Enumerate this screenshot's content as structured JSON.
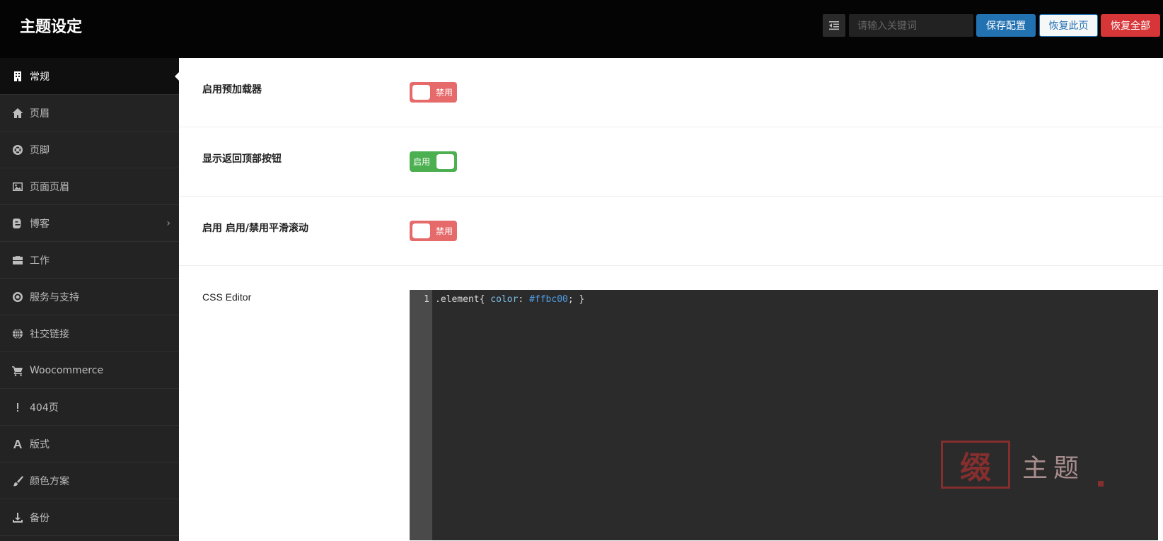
{
  "header": {
    "title": "主题设定",
    "search_placeholder": "请输入关键词",
    "save_label": "保存配置",
    "restore_label": "恢复此页",
    "reset_label": "恢复全部"
  },
  "sidebar": {
    "items": [
      {
        "label": "常规",
        "icon": "building-icon"
      },
      {
        "label": "页眉",
        "icon": "home-icon"
      },
      {
        "label": "页脚",
        "icon": "lifebuoy-icon"
      },
      {
        "label": "页面页眉",
        "icon": "image-icon"
      },
      {
        "label": "博客",
        "icon": "blogger-icon"
      },
      {
        "label": "工作",
        "icon": "briefcase-icon"
      },
      {
        "label": "服务与支持",
        "icon": "lifebuoy-icon"
      },
      {
        "label": "社交链接",
        "icon": "globe-icon"
      },
      {
        "label": "Woocommerce",
        "icon": "cart-icon"
      },
      {
        "label": "404页",
        "icon": "exclamation-icon"
      },
      {
        "label": "版式",
        "icon": "font-icon"
      },
      {
        "label": "颜色方案",
        "icon": "paint-brush-icon"
      },
      {
        "label": "备份",
        "icon": "download-icon"
      }
    ]
  },
  "settings": [
    {
      "label": "启用预加载器",
      "state_text": "禁用",
      "enabled": false
    },
    {
      "label": "显示返回顶部按钮",
      "state_text": "启用",
      "enabled": true
    },
    {
      "label": "启用 启用/禁用平滑滚动",
      "state_text": "禁用",
      "enabled": false
    }
  ],
  "css_editor": {
    "label": "CSS Editor",
    "line_number": "1",
    "code_selector": ".element{ ",
    "code_property": "color",
    "code_colon": ": ",
    "code_value": "#ffbc00",
    "code_end": "; }"
  },
  "watermark": {
    "stamp_char": "缀",
    "text": "主题"
  },
  "colors": {
    "accent": "#2271b1",
    "danger": "#d63638",
    "toggle_on": "#4caf50",
    "toggle_off": "#e66a6a"
  }
}
